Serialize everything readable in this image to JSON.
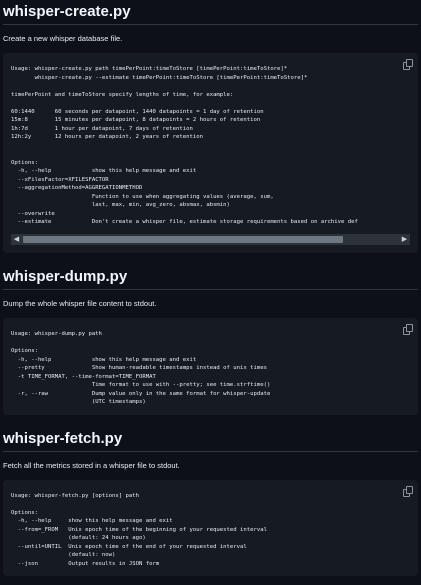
{
  "sections": [
    {
      "title": "whisper-create.py",
      "description": "Create a new whisper database file.",
      "code": "Usage: whisper-create.py path timePerPoint:timeToStore [timePerPoint:timeToStore]*\n       whisper-create.py --estimate timePerPoint:timeToStore [timePerPoint:timeToStore]*\n\ntimePerPoint and timeToStore specify lengths of time, for example:\n\n60:1440      60 seconds per datapoint, 1440 datapoints = 1 day of retention\n15m:8        15 minutes per datapoint, 8 datapoints = 2 hours of retention\n1h:7d        1 hour per datapoint, 7 days of retention\n12h:2y       12 hours per datapoint, 2 years of retention\n\n\nOptions:\n  -h, --help            show this help message and exit\n  --xFilesFactor=XFILESFACTOR\n  --aggregationMethod=AGGREGATIONMETHOD\n                        Function to use when aggregating values (average, sum,\n                        last, max, min, avg_zero, absmax, absmin)\n  --overwrite\n  --estimate            Don't create a whisper file, estimate storage requirements based on archive def"
    },
    {
      "title": "whisper-dump.py",
      "description": "Dump the whole whisper file content to stdout.",
      "code": "Usage: whisper-dump.py path\n\nOptions:\n  -h, --help            show this help message and exit\n  --pretty              Show human-readable timestamps instead of unix times\n  -t TIME_FORMAT, --time-format=TIME_FORMAT\n                        Time format to use with --pretty; see time.strftime()\n  -r, --raw             Dump value only in the same format for whisper-update\n                        (UTC timestamps)"
    },
    {
      "title": "whisper-fetch.py",
      "description": "Fetch all the metrics stored in a whisper file to stdout.",
      "code": "Usage: whisper-fetch.py [options] path\n\nOptions:\n  -h, --help     show this help message and exit\n  --from=_FROM   Unix epoch time of the beginning of your requested interval\n                 (default: 24 hours ago)\n  --until=UNTIL  Unix epoch time of the end of your requested interval\n                 (default: now)\n  --json         Output results in JSON form"
    }
  ],
  "icons": {
    "copy": "copy-icon",
    "left": "scroll-left-arrow-icon",
    "right": "scroll-right-arrow-icon"
  }
}
